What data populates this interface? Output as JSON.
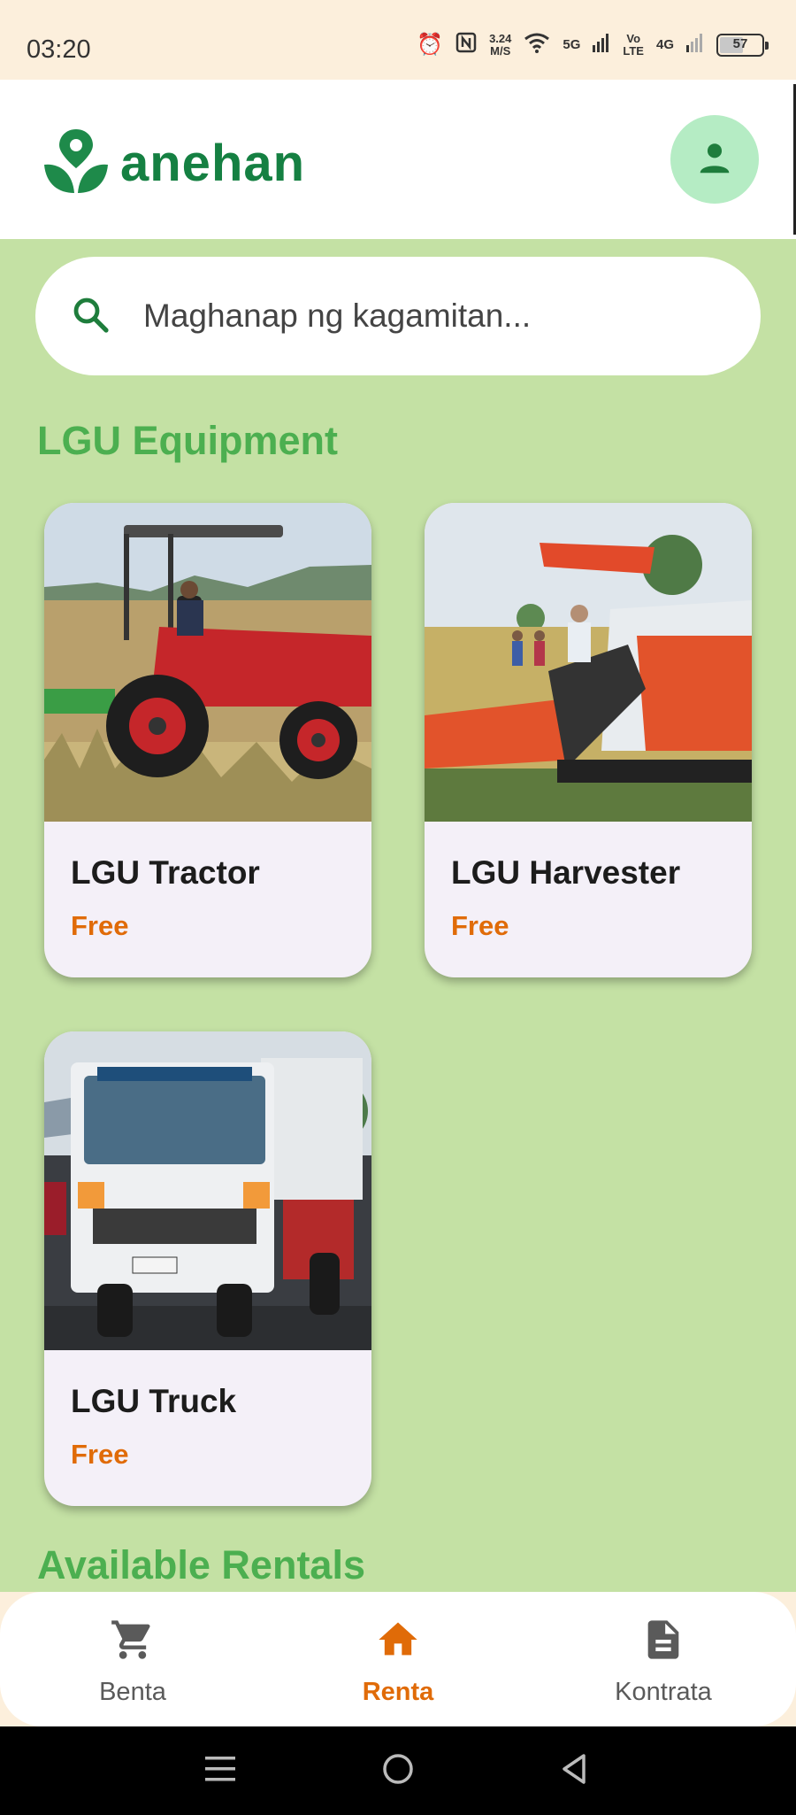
{
  "status_bar": {
    "time": "03:20",
    "speed_value": "3.24",
    "speed_unit": "M/S",
    "net_5g": "5G",
    "volte_top": "Vo",
    "volte_bottom": "LTE",
    "net_4g": "4G",
    "battery": "57"
  },
  "header": {
    "app_name": "anehan"
  },
  "search": {
    "placeholder": "Maghanap ng kagamitan..."
  },
  "sections": {
    "lgu_title": "LGU Equipment",
    "rentals_title": "Available Rentals"
  },
  "lgu_equipment": [
    {
      "name": "LGU Tractor",
      "price": "Free"
    },
    {
      "name": "LGU Harvester",
      "price": "Free"
    },
    {
      "name": "LGU Truck",
      "price": "Free"
    }
  ],
  "bottom_nav": [
    {
      "label": "Benta",
      "icon": "cart-icon",
      "active": false
    },
    {
      "label": "Renta",
      "icon": "home-icon",
      "active": true
    },
    {
      "label": "Kontrata",
      "icon": "document-icon",
      "active": false
    }
  ],
  "colors": {
    "brand_green": "#158042",
    "section_green": "#4caf50",
    "accent_orange": "#e06b08",
    "background": "#c4e1a4"
  }
}
